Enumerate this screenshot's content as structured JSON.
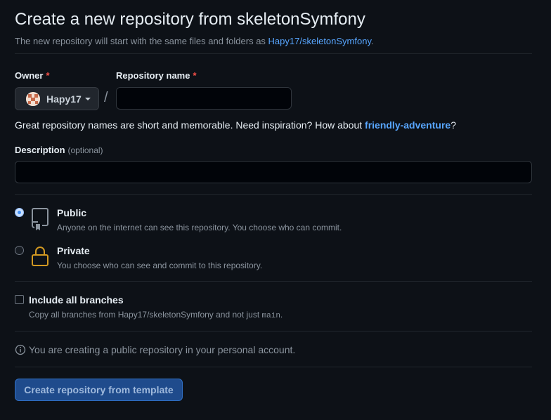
{
  "header": {
    "title": "Create a new repository from skeletonSymfony",
    "subtitle_prefix": "The new repository will start with the same files and folders as ",
    "subtitle_link": "Hapy17/skeletonSymfony",
    "subtitle_suffix": "."
  },
  "owner": {
    "label": "Owner",
    "required_mark": "*",
    "value": "Hapy17"
  },
  "separator": "/",
  "repo_name": {
    "label": "Repository name",
    "required_mark": "*",
    "value": ""
  },
  "name_hint": {
    "prefix": "Great repository names are short and memorable. Need inspiration? How about ",
    "suggestion": "friendly-adventure",
    "suffix": "?"
  },
  "description": {
    "label": "Description",
    "optional": "(optional)",
    "value": ""
  },
  "visibility": {
    "public": {
      "title": "Public",
      "desc": "Anyone on the internet can see this repository. You choose who can commit.",
      "selected": true
    },
    "private": {
      "title": "Private",
      "desc": "You choose who can see and commit to this repository.",
      "selected": false
    }
  },
  "branches": {
    "title": "Include all branches",
    "desc_prefix": "Copy all branches from Hapy17/skeletonSymfony and not just ",
    "desc_code": "main",
    "desc_suffix": ".",
    "checked": false
  },
  "info_text": "You are creating a public repository in your personal account.",
  "submit_label": "Create repository from template",
  "colors": {
    "background": "#0d1117",
    "link": "#58a6ff",
    "required": "#f85149",
    "lock_icon": "#d29922",
    "primary_button": "#1f4b8c"
  }
}
